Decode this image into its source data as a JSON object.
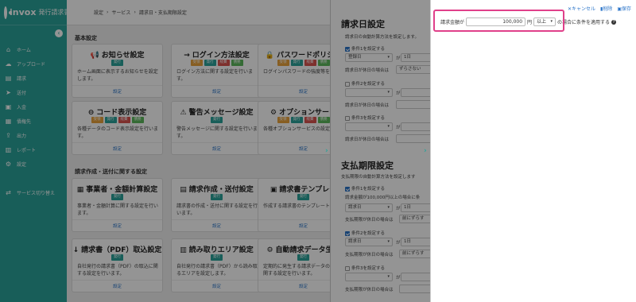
{
  "app": {
    "logo_text": "invox",
    "logo_sub": "発行請求書"
  },
  "breadcrumb": [
    "設定",
    "›",
    "サービス",
    "›",
    "請求日・支払期限設定"
  ],
  "sidebar": {
    "collapse_icon": "chevron-left-icon",
    "items": [
      {
        "label": "ホーム",
        "icon": "home-icon"
      },
      {
        "label": "アップロード",
        "icon": "upload-icon"
      },
      {
        "label": "請求",
        "icon": "invoice-icon"
      },
      {
        "label": "送付",
        "icon": "send-icon"
      },
      {
        "label": "入金",
        "icon": "payment-icon"
      },
      {
        "label": "債権先",
        "icon": "customer-icon"
      },
      {
        "label": "出力",
        "icon": "export-icon"
      },
      {
        "label": "レポート",
        "icon": "report-icon"
      },
      {
        "label": "設定",
        "icon": "gear-icon"
      },
      {
        "label": "サービス切り替え",
        "icon": "switch-icon"
      }
    ]
  },
  "main": {
    "section1": "基本設定",
    "section2": "請求作成・送付に関する設定",
    "cards": [
      {
        "title": "お知らせ設定",
        "icon": "📢",
        "badges": [
          "発行"
        ],
        "desc": "ホーム画面に表示するお知らせを設定します。",
        "link": "設定"
      },
      {
        "title": "ログイン方法設定",
        "icon": "→",
        "badges": [
          "受領",
          "発行",
          "経費",
          "債務"
        ],
        "desc": "ログイン方法に関する設定を行います。",
        "link": "設定"
      },
      {
        "title": "パスワードポリシー",
        "icon": "🔒",
        "badges": [
          "受領",
          "発行",
          "経費",
          "債務"
        ],
        "desc": "ログインパスワードの強度等を",
        "link": "設定"
      },
      {
        "title": "コード表示設定",
        "icon": "⊖",
        "badges": [
          "受領",
          "発行",
          "経費",
          "債務"
        ],
        "desc": "各種データのコード表示設定を行います。",
        "link": "設定"
      },
      {
        "title": "警告メッセージ設定",
        "icon": "⚠",
        "badges": [
          "発行"
        ],
        "desc": "警告メッセージに関する設定を行います。",
        "link": "設定"
      },
      {
        "title": "オプションサービ",
        "icon": "⚙",
        "badges": [
          "受領",
          "発行",
          "経費",
          "債務"
        ],
        "desc": "各種オプションサービスの設定",
        "link": "設定"
      },
      {
        "title": "事業者・金額計算設定",
        "icon": "▦",
        "badges": [
          "発行"
        ],
        "desc": "事業者・金額計算に関する設定を行います。",
        "link": "設定"
      },
      {
        "title": "請求作成・送付設定",
        "icon": "▤",
        "badges": [
          "発行"
        ],
        "desc": "請求書の作成・送付に関する設定を行います。",
        "link": "設定"
      },
      {
        "title": "請求書テンプレー",
        "icon": "▣",
        "badges": [
          "発行"
        ],
        "desc": "作成する請求書のテンプレート",
        "link": "設定"
      },
      {
        "title": "請求書（PDF）取込設定",
        "icon": "↓",
        "badges": [
          "発行"
        ],
        "desc": "自社発行の請求書（PDF）の取込に関する設定を行います。",
        "link": "設定"
      },
      {
        "title": "読み取りエリア設定",
        "icon": "▥",
        "badges": [
          "発行"
        ],
        "desc": "自社発行の請求書（PDF）から読み取るエリアを設定します。",
        "link": "設定"
      },
      {
        "title": "自動請求データ生成",
        "icon": "⚙",
        "badges": [
          "発行"
        ],
        "desc": "定期的に発生する請求データの生成に関する設定を行います。",
        "link": "設定"
      }
    ]
  },
  "panel1": {
    "title1": "請求日設定",
    "desc1": "請求日の自動計算方法を設定します。",
    "cond1": "条件1を設定する",
    "cond1_sel": "登録日",
    "ga": "が",
    "day1": "1日",
    "holiday": "請求日が休日の場合は",
    "holiday_val": "ずらさない",
    "cond2": "条件2を設定する",
    "cond3": "条件3を設定する",
    "title2": "支払期限設定",
    "desc2": "支払期限の自動計算方法を設定します",
    "p_cond1": "条件1を設定する",
    "p_cond1_desc": "請求金額が100,000円以上の場合に条",
    "p_sel": "請求日",
    "p_day": "1日",
    "p_holiday": "支払期限が休日の場合は",
    "p_holiday_val": "前にずらす",
    "p_cond2": "条件2を設定する",
    "p_cond3": "条件3を設定する"
  },
  "panel2": {
    "cancel": "キャンセル",
    "delete": "削除",
    "save": "保存",
    "label": "請求金額が",
    "amount": "100,000",
    "yen": "円",
    "op": "以上",
    "suffix": "の場合に条件を適用する",
    "help": "?"
  },
  "colors": {
    "accent": "#2aa39a",
    "highlight": "#e0408a",
    "link": "#2a74c9"
  }
}
